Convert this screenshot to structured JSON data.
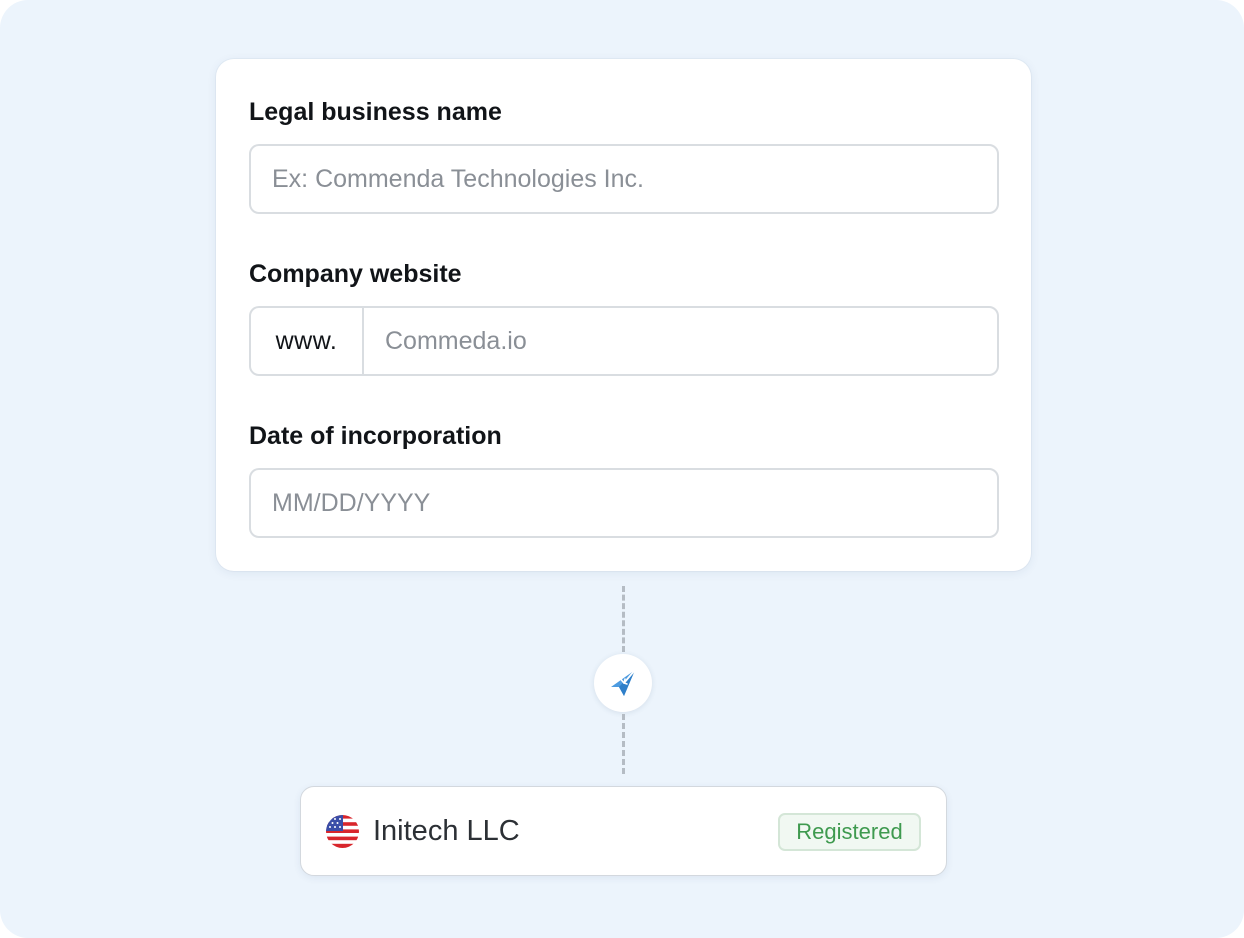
{
  "form": {
    "business_name": {
      "label": "Legal business name",
      "placeholder": "Ex: Commenda Technologies Inc.",
      "value": ""
    },
    "website": {
      "label": "Company website",
      "prefix": "www.",
      "placeholder": "Commeda.io",
      "value": ""
    },
    "incorporation_date": {
      "label": "Date of incorporation",
      "placeholder": "MM/DD/YYYY",
      "value": ""
    }
  },
  "connector": {
    "icon": "paper-plane-icon",
    "accent_color": "#4d9be0"
  },
  "entity": {
    "flag_icon": "us-flag-icon",
    "name": "Initech LLC",
    "status": "Registered",
    "status_color": "#3f9a4f"
  }
}
